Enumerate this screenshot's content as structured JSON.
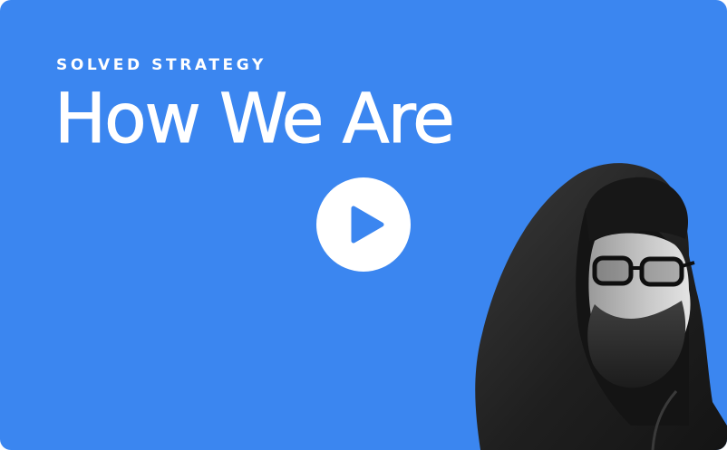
{
  "colors": {
    "background": "#3B86F0",
    "text": "#FFFFFF",
    "play_button": "#FFFFFF",
    "play_icon": "#3B86F0"
  },
  "video": {
    "eyebrow": "SOLVED STRATEGY",
    "title": "How We Are",
    "play_icon": "play-icon",
    "presenter_image": "bearded man in black hood, beanie and glasses"
  }
}
